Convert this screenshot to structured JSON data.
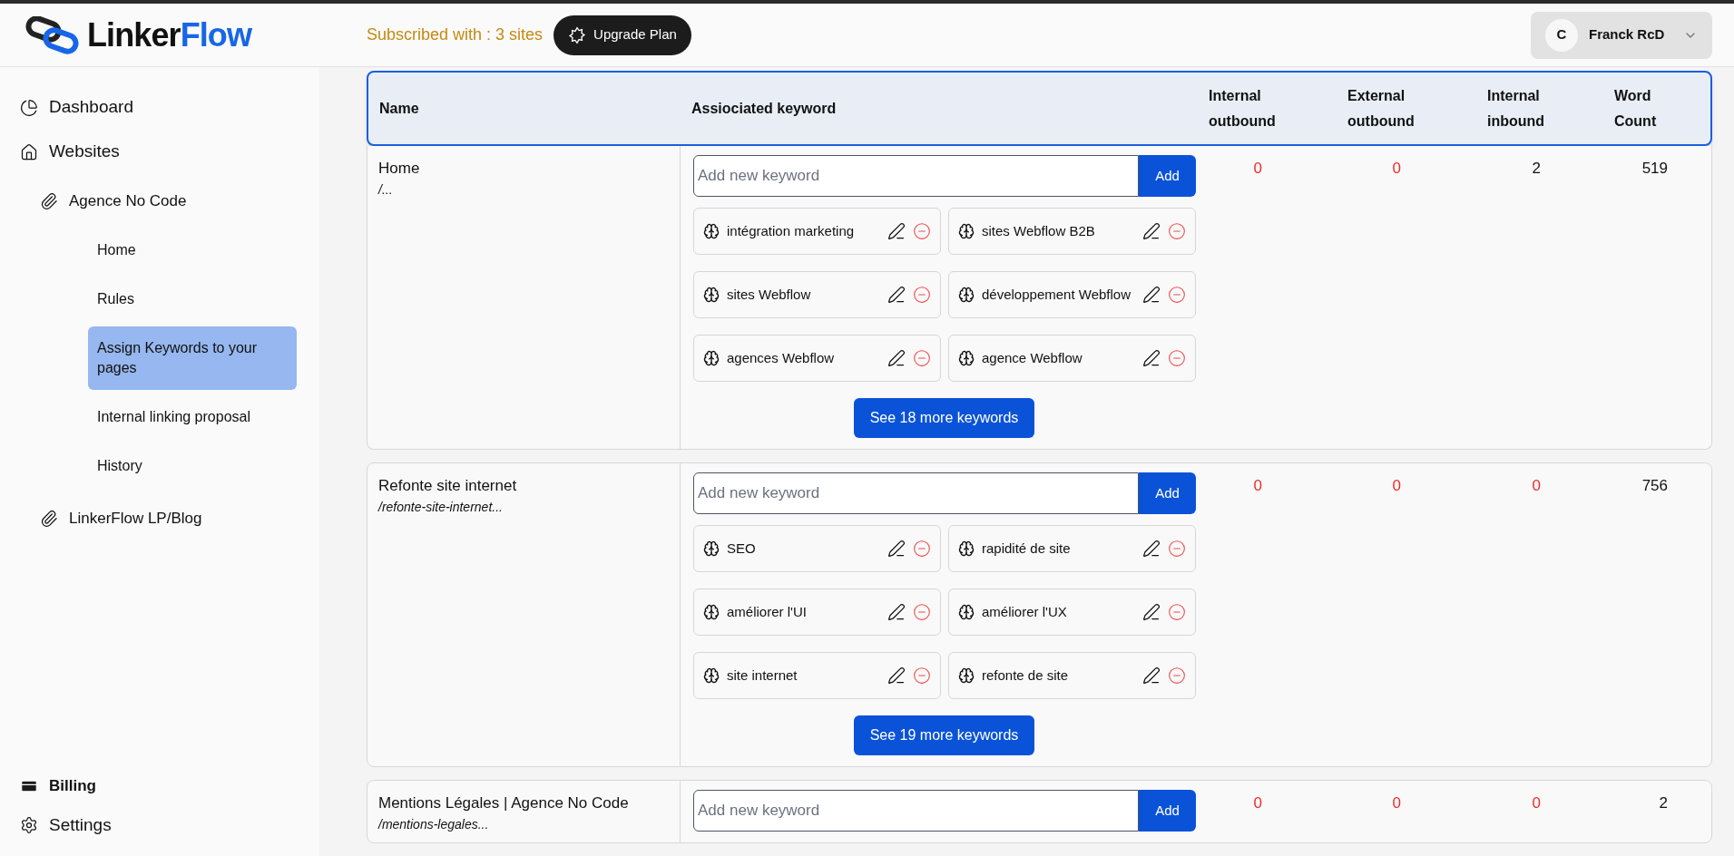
{
  "logo": {
    "text_1": "Linker",
    "text_2": "Flow"
  },
  "header": {
    "subscription": "Subscribed with : 3 sites",
    "upgrade_button": "Upgrade Plan",
    "user": {
      "initial": "C",
      "name": "Franck RcD"
    }
  },
  "sidebar": {
    "items": [
      {
        "kind": "pie",
        "label": "Dashboard"
      },
      {
        "kind": "home",
        "label": "Websites",
        "children": [
          {
            "label": "Agence No Code",
            "children": [
              {
                "label": "Home",
                "selected": false
              },
              {
                "label": "Rules",
                "selected": false
              },
              {
                "label": "Assign Keywords to your pages",
                "selected": true
              },
              {
                "label": "Internal linking proposal",
                "selected": false
              },
              {
                "label": "History",
                "selected": false
              }
            ]
          },
          {
            "label": "LinkerFlow LP/Blog"
          }
        ]
      }
    ],
    "bottom": [
      {
        "kind": "card",
        "label": "Billing"
      },
      {
        "kind": "gear",
        "label": "Settings"
      }
    ]
  },
  "table": {
    "columns": [
      "Name",
      "Assiociated keyword",
      "Internal outbound",
      "External outbound",
      "Internal inbound",
      "Word Count"
    ],
    "rows": [
      {
        "name": "Home",
        "path": "/...",
        "placeholder": "Add new keyword",
        "add": "Add",
        "keywords": [
          "intégration marketing",
          "sites Webflow B2B",
          "sites Webflow",
          "développement Webflow",
          "agences Webflow",
          "agence Webflow"
        ],
        "more": "See 18 more keywords",
        "stats": [
          {
            "value": "0",
            "warning": true
          },
          {
            "value": "0",
            "warning": true
          },
          {
            "value": "2",
            "warning": false
          },
          {
            "value": "519",
            "warning": false
          }
        ]
      },
      {
        "name": "Refonte site internet",
        "path": "/refonte-site-internet...",
        "placeholder": "Add new keyword",
        "add": "Add",
        "keywords": [
          "SEO",
          "rapidité de site",
          "améliorer l'UI",
          "améliorer l'UX",
          "site internet",
          "refonte de site"
        ],
        "more": "See 19 more keywords",
        "stats": [
          {
            "value": "0",
            "warning": true
          },
          {
            "value": "0",
            "warning": true
          },
          {
            "value": "0",
            "warning": true
          },
          {
            "value": "756",
            "warning": false
          }
        ]
      },
      {
        "name": "Mentions Légales | Agence No Code",
        "path": "/mentions-legales...",
        "placeholder": "Add new keyword",
        "add": "Add",
        "keywords": [],
        "stats": [
          {
            "value": "0",
            "warning": true
          },
          {
            "value": "0",
            "warning": true
          },
          {
            "value": "0",
            "warning": true
          },
          {
            "value": "2",
            "warning": false
          }
        ]
      }
    ]
  }
}
